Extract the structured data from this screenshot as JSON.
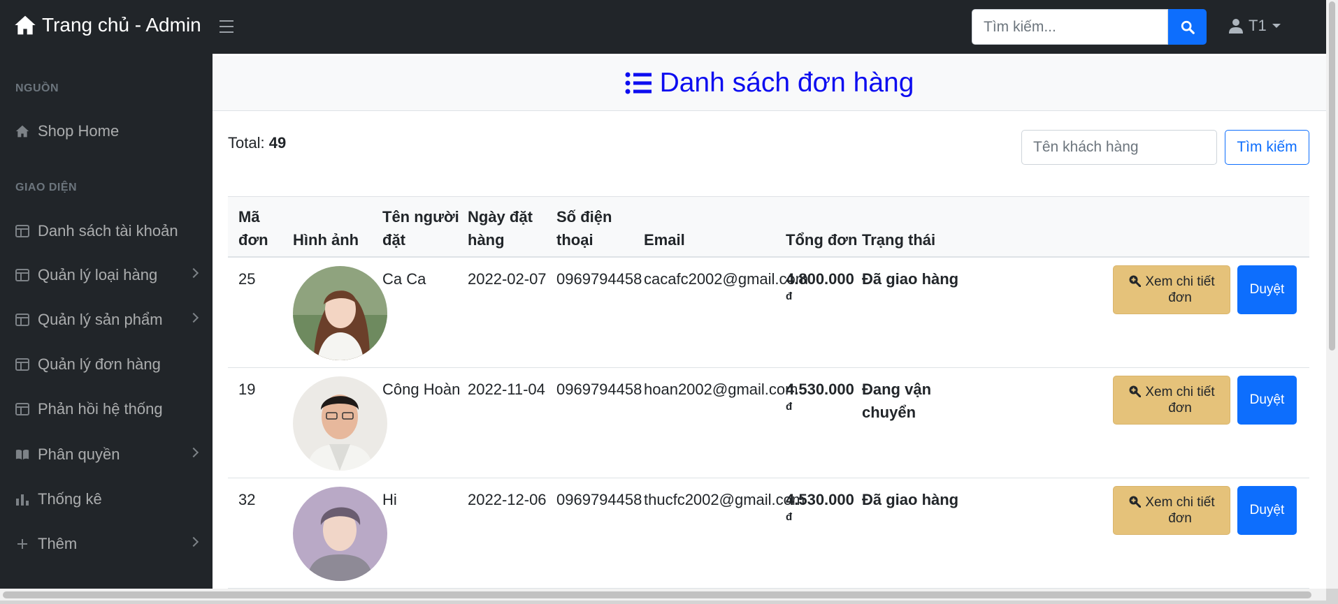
{
  "navbar": {
    "brand": "Trang chủ - Admin",
    "search_placeholder": "Tìm kiếm...",
    "user": "T1"
  },
  "sidebar": {
    "heading_source": "NGUỒN",
    "heading_ui": "GIAO DIỆN",
    "items": [
      {
        "label": "Shop Home",
        "icon": "home-icon"
      },
      {
        "label": "Danh sách tài khoản",
        "icon": "table-icon"
      },
      {
        "label": "Quản lý loại hàng",
        "icon": "table-icon"
      },
      {
        "label": "Quản lý sản phẩm",
        "icon": "table-icon"
      },
      {
        "label": "Quản lý đơn hàng",
        "icon": "table-icon"
      },
      {
        "label": "Phản hồi hệ thống",
        "icon": "table-icon"
      },
      {
        "label": "Phân quyền",
        "icon": "book-icon"
      },
      {
        "label": "Thống kê",
        "icon": "chart-icon"
      },
      {
        "label": "Thêm",
        "icon": "plus-icon"
      }
    ]
  },
  "page": {
    "title": "Danh sách đơn hàng",
    "total_label": "Total:",
    "total_value": "49",
    "filter_placeholder": "Tên khách hàng",
    "filter_button": "Tìm kiếm"
  },
  "table": {
    "headers": {
      "id_l1": "Mã",
      "id_l2": "đơn",
      "image": "Hình ảnh",
      "name_l1": "Tên người",
      "name_l2": "đặt",
      "date_l1": "Ngày đặt",
      "date_l2": "hàng",
      "phone_l1": "Số điện",
      "phone_l2": "thoại",
      "email": "Email",
      "total": "Tổng đơn",
      "status": "Trạng thái"
    },
    "view_button_l1": "Xem chi tiết",
    "view_button_l2": "đơn",
    "approve_button": "Duyệt",
    "currency": "đ",
    "rows": [
      {
        "id": "25",
        "name": "Ca Ca",
        "date": "2022-02-07",
        "phone": "0969794458",
        "email": "cacafc2002@gmail.com",
        "total": "4.800.000",
        "status_l1": "Đã giao hàng",
        "status_l2": ""
      },
      {
        "id": "19",
        "name": "Công Hoàn",
        "date": "2022-11-04",
        "phone": "0969794458",
        "email": "hoan2002@gmail.com",
        "total": "4.530.000",
        "status_l1": "Đang vận",
        "status_l2": "chuyển"
      },
      {
        "id": "32",
        "name": "Hi",
        "date": "2022-12-06",
        "phone": "0969794458",
        "email": "thucfc2002@gmail.com",
        "total": "4.530.000",
        "status_l1": "Đã giao hàng",
        "status_l2": ""
      }
    ]
  },
  "colors": {
    "dark": "#212529",
    "primary": "#0d6efd",
    "warning": "#e5c27a",
    "title": "#0d0df0"
  }
}
